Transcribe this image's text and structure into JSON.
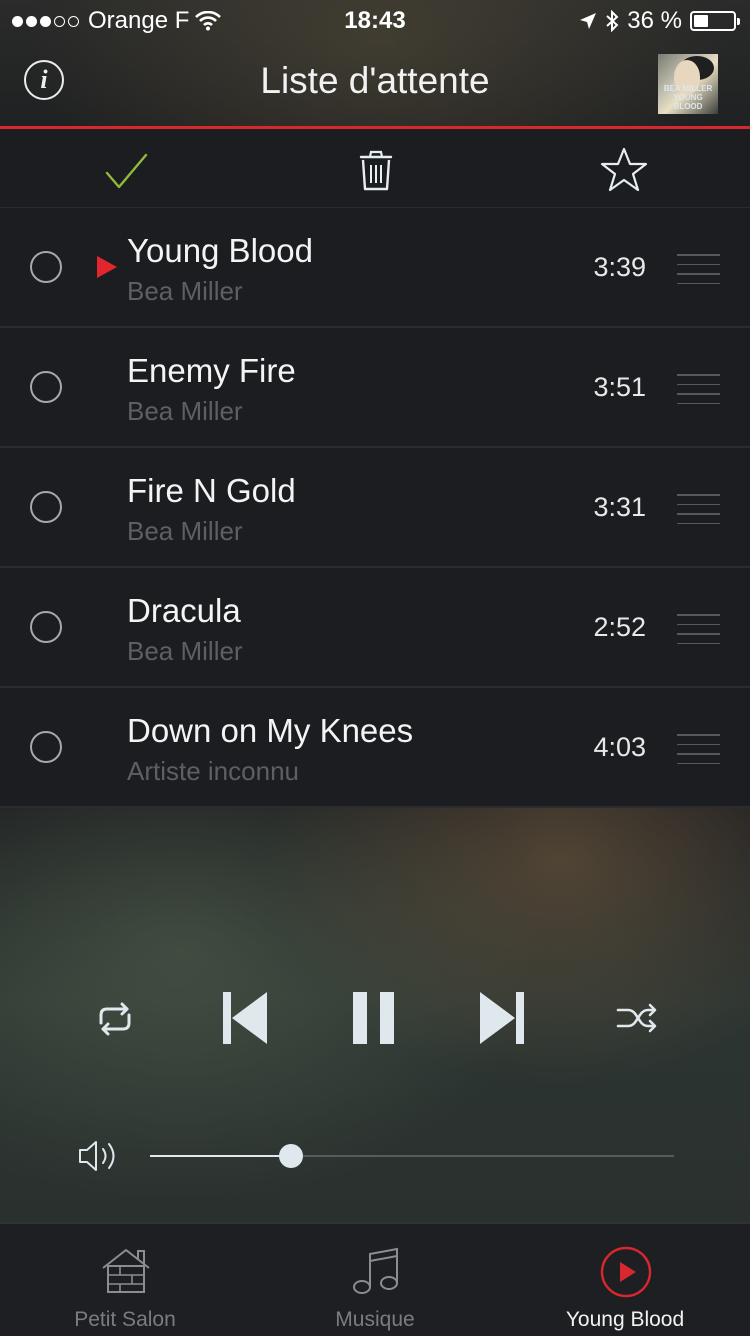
{
  "status_bar": {
    "carrier": "Orange F",
    "time": "18:43",
    "battery_percent": "36 %",
    "battery_level": 0.36
  },
  "header": {
    "title": "Liste d'attente",
    "album_caption_line1": "BEA MILLER",
    "album_caption_line2": "YOUNG BLOOD"
  },
  "queue": [
    {
      "title": "Young Blood",
      "artist": "Bea Miller",
      "duration": "3:39",
      "playing": true
    },
    {
      "title": "Enemy Fire",
      "artist": "Bea Miller",
      "duration": "3:51",
      "playing": false
    },
    {
      "title": "Fire N Gold",
      "artist": "Bea Miller",
      "duration": "3:31",
      "playing": false
    },
    {
      "title": "Dracula",
      "artist": "Bea Miller",
      "duration": "2:52",
      "playing": false
    },
    {
      "title": "Down on My Knees",
      "artist": "Artiste inconnu",
      "duration": "4:03",
      "playing": false
    }
  ],
  "player": {
    "volume_level": 0.27
  },
  "tabs": [
    {
      "label": "Petit Salon",
      "icon": "house-icon",
      "active": false
    },
    {
      "label": "Musique",
      "icon": "music-note-icon",
      "active": false
    },
    {
      "label": "Young Blood",
      "icon": "now-playing-icon",
      "active": true
    }
  ],
  "colors": {
    "accent": "#d9272e",
    "check": "#8dbb3a",
    "icon": "#dfe8ec"
  }
}
